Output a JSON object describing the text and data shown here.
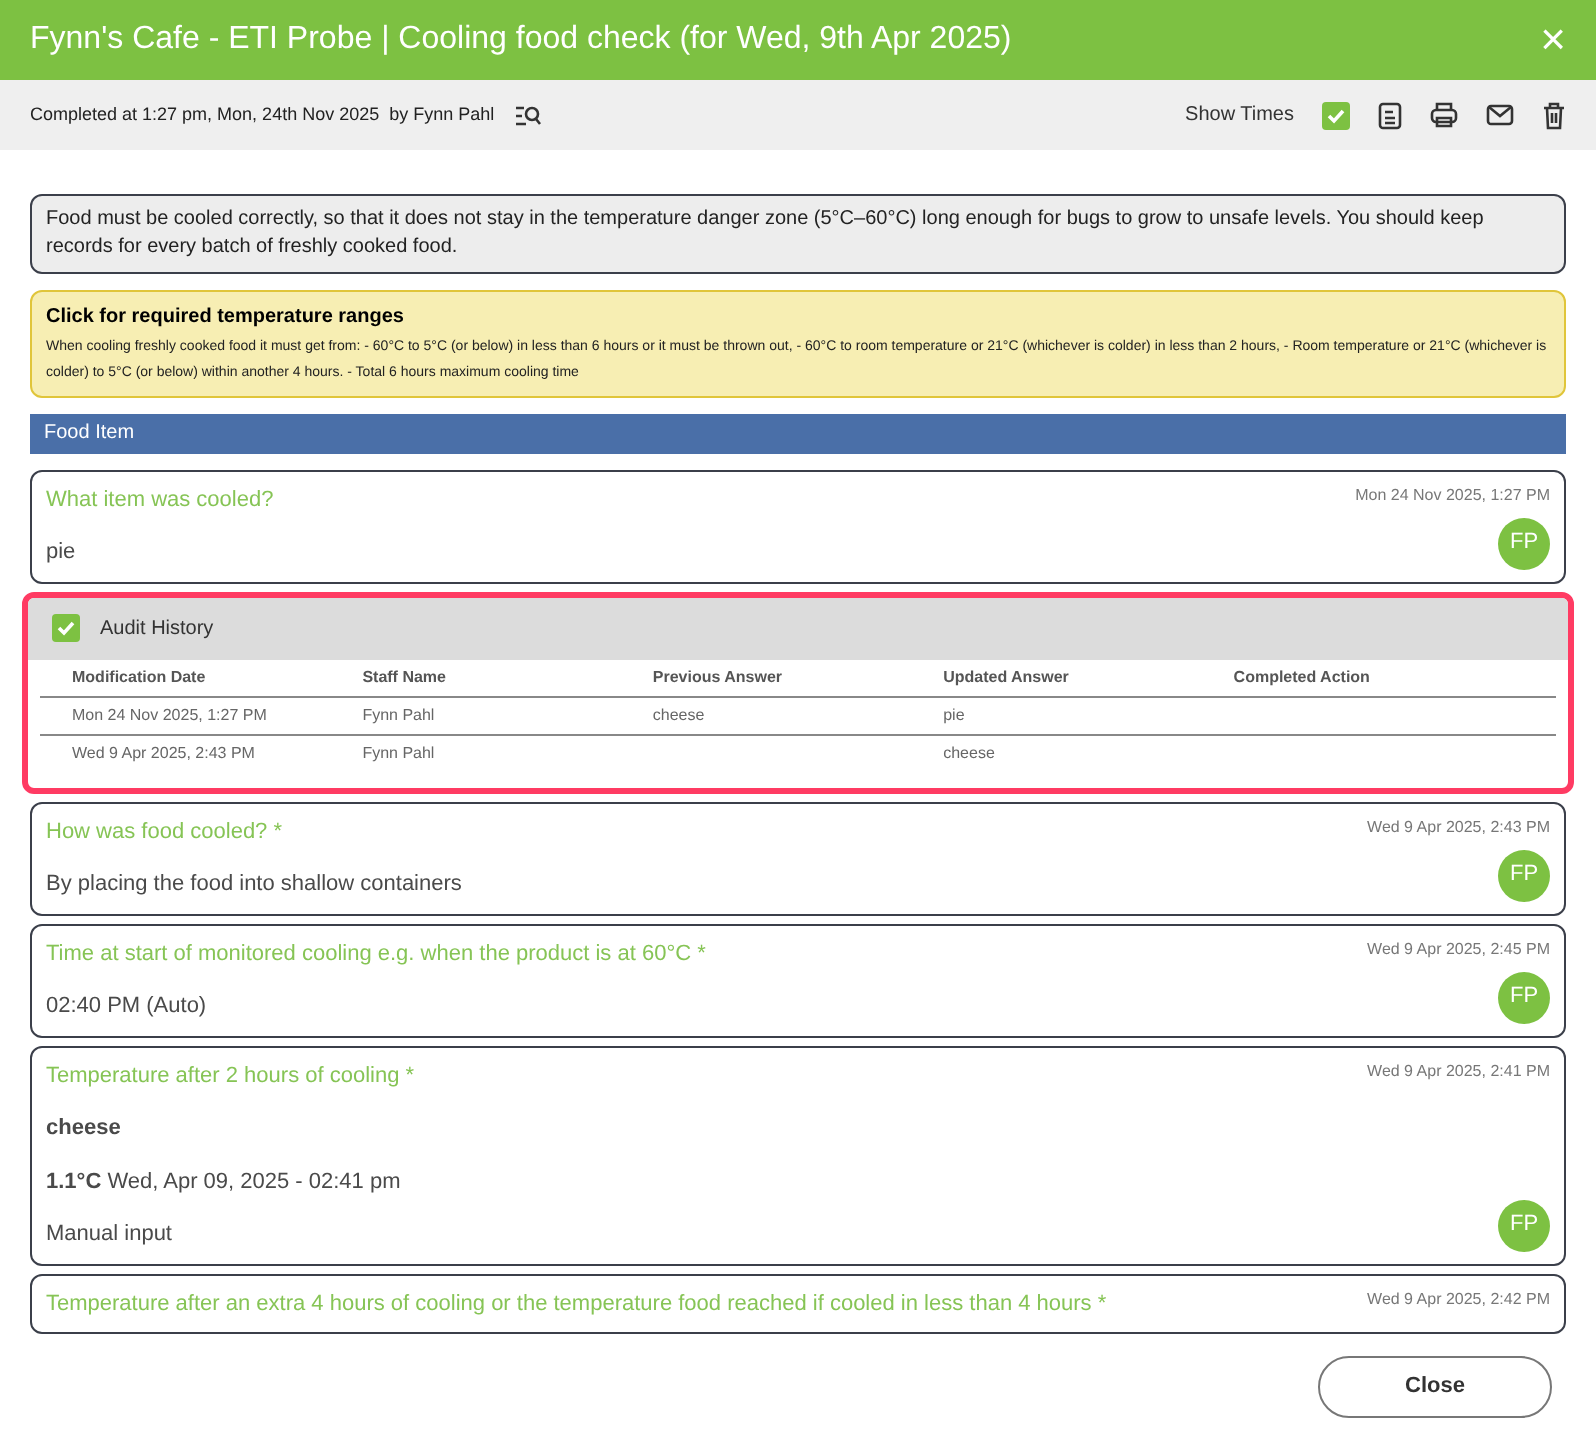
{
  "window": {
    "title": "Fynn's Cafe - ETI Probe | Cooling food check (for Wed, 9th Apr 2025)",
    "close": "×"
  },
  "toolbar": {
    "completed": "Completed at 1:27 pm, Mon, 24th Nov 2025  by Fynn Pahl",
    "show_times_label": "Show Times",
    "show_times_checked": true
  },
  "info": "Food must be cooled correctly, so that it does not stay in the temperature danger zone (5°C–60°C) long enough for bugs to grow to unsafe levels. You should keep records for every batch of freshly cooked food.",
  "ranges": {
    "title": "Click for required temperature ranges",
    "text": "When cooling freshly cooked food it must get from: - 60°C to 5°C (or below) in less than 6 hours or it must be thrown out, - 60°C to room temperature or 21°C (whichever is colder) in less than 2 hours, - Room temperature or 21°C (whichever is colder) to 5°C (or below) within another 4 hours. - Total 6 hours maximum cooling time"
  },
  "section": "Food Item",
  "items": [
    {
      "kind": "question",
      "question": "What item was cooled?",
      "time": "Mon 24 Nov 2025, 1:27 PM",
      "lines": [
        {
          "text": "pie",
          "bold": false
        }
      ],
      "avatar": "FP"
    },
    {
      "kind": "audit",
      "title": "Audit History",
      "checked": true,
      "columns": [
        "Modification Date",
        "Staff Name",
        "Previous Answer",
        "Updated Answer",
        "Completed Action"
      ],
      "rows": [
        [
          "Mon 24 Nov 2025, 1:27 PM",
          "Fynn Pahl",
          "cheese",
          "pie",
          ""
        ],
        [
          "Wed 9 Apr 2025, 2:43 PM",
          "Fynn Pahl",
          "",
          "cheese",
          ""
        ]
      ]
    },
    {
      "kind": "question",
      "question": "How was food cooled? *",
      "time": "Wed 9 Apr 2025, 2:43 PM",
      "lines": [
        {
          "text": "By placing the food into shallow containers",
          "bold": false
        }
      ],
      "avatar": "FP"
    },
    {
      "kind": "question",
      "question": "Time at start of monitored cooling e.g. when the product is at 60°C *",
      "time": "Wed 9 Apr 2025, 2:45 PM",
      "lines": [
        {
          "text": "02:40 PM (Auto)",
          "bold": false
        }
      ],
      "avatar": "FP"
    },
    {
      "kind": "question",
      "question": "Temperature after 2 hours of cooling *",
      "time": "Wed 9 Apr 2025, 2:41 PM",
      "lines": [
        {
          "text": "cheese",
          "bold": true
        },
        {
          "text": "**1.1°C** Wed, Apr 09, 2025 - 02:41 pm",
          "bold": false
        },
        {
          "text": "Manual input",
          "bold": false
        }
      ],
      "avatar": "FP"
    },
    {
      "kind": "question",
      "question": "Temperature after an extra 4 hours of cooling or the temperature food reached if cooled in less than 4 hours *",
      "time": "Wed 9 Apr 2025, 2:42 PM"
    }
  ],
  "footer": {
    "close": "Close"
  }
}
